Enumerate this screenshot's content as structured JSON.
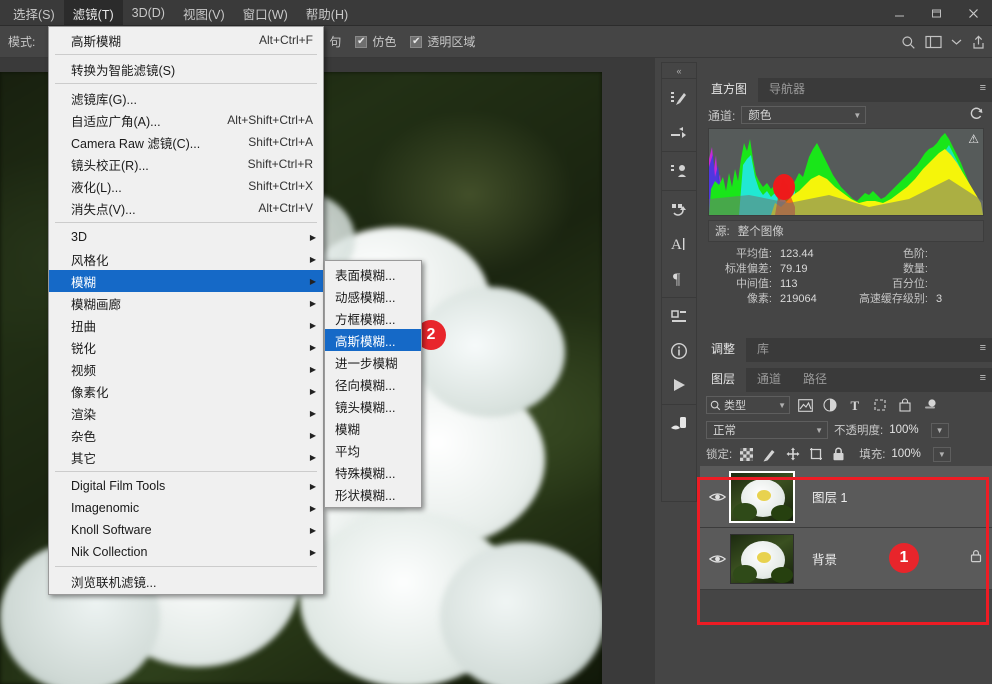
{
  "window": {
    "buttons": [
      {
        "name": "minimize",
        "glyph": "—"
      },
      {
        "name": "maximize",
        "glyph": "▢"
      },
      {
        "name": "close",
        "glyph": "✕"
      }
    ]
  },
  "menubar": {
    "items": [
      {
        "label": "选择(S)",
        "active": false
      },
      {
        "label": "滤镜(T)",
        "active": true
      },
      {
        "label": "3D(D)",
        "active": false
      },
      {
        "label": "视图(V)",
        "active": false
      },
      {
        "label": "窗口(W)",
        "active": false
      },
      {
        "label": "帮助(H)",
        "active": false
      }
    ]
  },
  "options_bar": {
    "mode_label": "模式:",
    "trailing_text": "句",
    "checkboxes": [
      {
        "label": "仿色",
        "checked": true,
        "mark": "✔"
      },
      {
        "label": "透明区域",
        "checked": true,
        "mark": "✔"
      }
    ],
    "right_icons": [
      {
        "name": "search-icon"
      },
      {
        "name": "workspace-icon"
      },
      {
        "name": "chevron-down-icon"
      },
      {
        "name": "share-icon"
      }
    ]
  },
  "filter_menu": {
    "items": [
      {
        "label": "高斯模糊",
        "shortcut": "Alt+Ctrl+F",
        "submenu": false,
        "highlight": false
      },
      {
        "sep": true
      },
      {
        "label": "转换为智能滤镜(S)",
        "shortcut": "",
        "submenu": false,
        "highlight": false
      },
      {
        "sep": true
      },
      {
        "label": "滤镜库(G)...",
        "shortcut": "",
        "submenu": false,
        "highlight": false
      },
      {
        "label": "自适应广角(A)...",
        "shortcut": "Alt+Shift+Ctrl+A",
        "submenu": false,
        "highlight": false
      },
      {
        "label": "Camera Raw 滤镜(C)...",
        "shortcut": "Shift+Ctrl+A",
        "submenu": false,
        "highlight": false
      },
      {
        "label": "镜头校正(R)...",
        "shortcut": "Shift+Ctrl+R",
        "submenu": false,
        "highlight": false
      },
      {
        "label": "液化(L)...",
        "shortcut": "Shift+Ctrl+X",
        "submenu": false,
        "highlight": false
      },
      {
        "label": "消失点(V)...",
        "shortcut": "Alt+Ctrl+V",
        "submenu": false,
        "highlight": false
      },
      {
        "sep": true
      },
      {
        "label": "3D",
        "shortcut": "",
        "submenu": true,
        "highlight": false
      },
      {
        "label": "风格化",
        "shortcut": "",
        "submenu": true,
        "highlight": false
      },
      {
        "label": "模糊",
        "shortcut": "",
        "submenu": true,
        "highlight": true
      },
      {
        "label": "模糊画廊",
        "shortcut": "",
        "submenu": true,
        "highlight": false
      },
      {
        "label": "扭曲",
        "shortcut": "",
        "submenu": true,
        "highlight": false
      },
      {
        "label": "锐化",
        "shortcut": "",
        "submenu": true,
        "highlight": false
      },
      {
        "label": "视频",
        "shortcut": "",
        "submenu": true,
        "highlight": false
      },
      {
        "label": "像素化",
        "shortcut": "",
        "submenu": true,
        "highlight": false
      },
      {
        "label": "渲染",
        "shortcut": "",
        "submenu": true,
        "highlight": false
      },
      {
        "label": "杂色",
        "shortcut": "",
        "submenu": true,
        "highlight": false
      },
      {
        "label": "其它",
        "shortcut": "",
        "submenu": true,
        "highlight": false
      },
      {
        "sep": true
      },
      {
        "label": "Digital Film Tools",
        "shortcut": "",
        "submenu": true,
        "highlight": false
      },
      {
        "label": "Imagenomic",
        "shortcut": "",
        "submenu": true,
        "highlight": false
      },
      {
        "label": "Knoll Software",
        "shortcut": "",
        "submenu": true,
        "highlight": false
      },
      {
        "label": "Nik Collection",
        "shortcut": "",
        "submenu": true,
        "highlight": false
      },
      {
        "sep": true
      },
      {
        "label": "浏览联机滤镜...",
        "shortcut": "",
        "submenu": false,
        "highlight": false
      }
    ]
  },
  "blur_submenu": {
    "items": [
      {
        "label": "表面模糊...",
        "highlight": false
      },
      {
        "label": "动感模糊...",
        "highlight": false
      },
      {
        "label": "方框模糊...",
        "highlight": false
      },
      {
        "label": "高斯模糊...",
        "highlight": true
      },
      {
        "label": "进一步模糊",
        "highlight": false
      },
      {
        "label": "径向模糊...",
        "highlight": false
      },
      {
        "label": "镜头模糊...",
        "highlight": false
      },
      {
        "label": "模糊",
        "highlight": false
      },
      {
        "label": "平均",
        "highlight": false
      },
      {
        "label": "特殊模糊...",
        "highlight": false
      },
      {
        "label": "形状模糊...",
        "highlight": false
      }
    ]
  },
  "annotations": {
    "badge_1": "1",
    "badge_2": "2",
    "accent_color": "#ed1c24"
  },
  "dock": {
    "collapse_glyph": "«",
    "groups": [
      [
        {
          "name": "brush-presets-icon"
        },
        {
          "name": "brush-settings-icon"
        }
      ],
      [
        {
          "name": "clone-source-icon"
        }
      ],
      [
        {
          "name": "adjustments-icon"
        },
        {
          "name": "character-icon"
        },
        {
          "name": "paragraph-icon"
        }
      ],
      [
        {
          "name": "properties-icon"
        },
        {
          "name": "info-icon"
        },
        {
          "name": "timeline-icon"
        }
      ],
      [
        {
          "name": "tool-presets-icon"
        }
      ]
    ]
  },
  "histogram_panel": {
    "tabs": [
      {
        "label": "直方图",
        "selected": true
      },
      {
        "label": "导航器",
        "selected": false
      }
    ],
    "menu_glyph": "≡",
    "channel_label": "通道:",
    "channel_value": "颜色",
    "refresh_icon": "refresh-icon",
    "warning_icon": "warning-icon",
    "source_label": "源:",
    "source_value": "整个图像",
    "stats_left": [
      {
        "label": "平均值:",
        "value": "123.44"
      },
      {
        "label": "标准偏差:",
        "value": "79.19"
      },
      {
        "label": "中间值:",
        "value": "113"
      },
      {
        "label": "像素:",
        "value": "219064"
      }
    ],
    "stats_right": [
      {
        "label": "色阶:",
        "value": ""
      },
      {
        "label": "数量:",
        "value": ""
      },
      {
        "label": "百分位:",
        "value": ""
      },
      {
        "label": "高速缓存级别:",
        "value": "3"
      }
    ]
  },
  "adjust_panel": {
    "tabs": [
      {
        "label": "调整",
        "selected": true
      },
      {
        "label": "库",
        "selected": false
      }
    ],
    "menu_glyph": "≡"
  },
  "layers_panel": {
    "tabs": [
      {
        "label": "图层",
        "selected": true
      },
      {
        "label": "通道",
        "selected": false
      },
      {
        "label": "路径",
        "selected": false
      }
    ],
    "menu_glyph": "≡",
    "filter_label": "类型",
    "filter_icon": "search-icon",
    "filter_tools": [
      {
        "name": "pixel-filter-icon"
      },
      {
        "name": "adjustment-filter-icon"
      },
      {
        "name": "type-filter-icon"
      },
      {
        "name": "shape-filter-icon"
      },
      {
        "name": "smart-object-filter-icon"
      },
      {
        "name": "filter-toggle-icon"
      }
    ],
    "blend_mode": "正常",
    "opacity_label": "不透明度:",
    "opacity_value": "100%",
    "lock_label": "锁定:",
    "lock_icons": [
      {
        "name": "lock-transparency-icon"
      },
      {
        "name": "lock-image-icon"
      },
      {
        "name": "lock-position-icon"
      },
      {
        "name": "lock-artboard-icon"
      },
      {
        "name": "lock-all-icon"
      }
    ],
    "fill_label": "填充:",
    "fill_value": "100%",
    "layers": [
      {
        "name": "图层 1",
        "suffix": "",
        "selected": true,
        "visible": true,
        "locked": false
      },
      {
        "name": "背景",
        "suffix": "",
        "selected": false,
        "visible": true,
        "locked": true
      }
    ]
  }
}
